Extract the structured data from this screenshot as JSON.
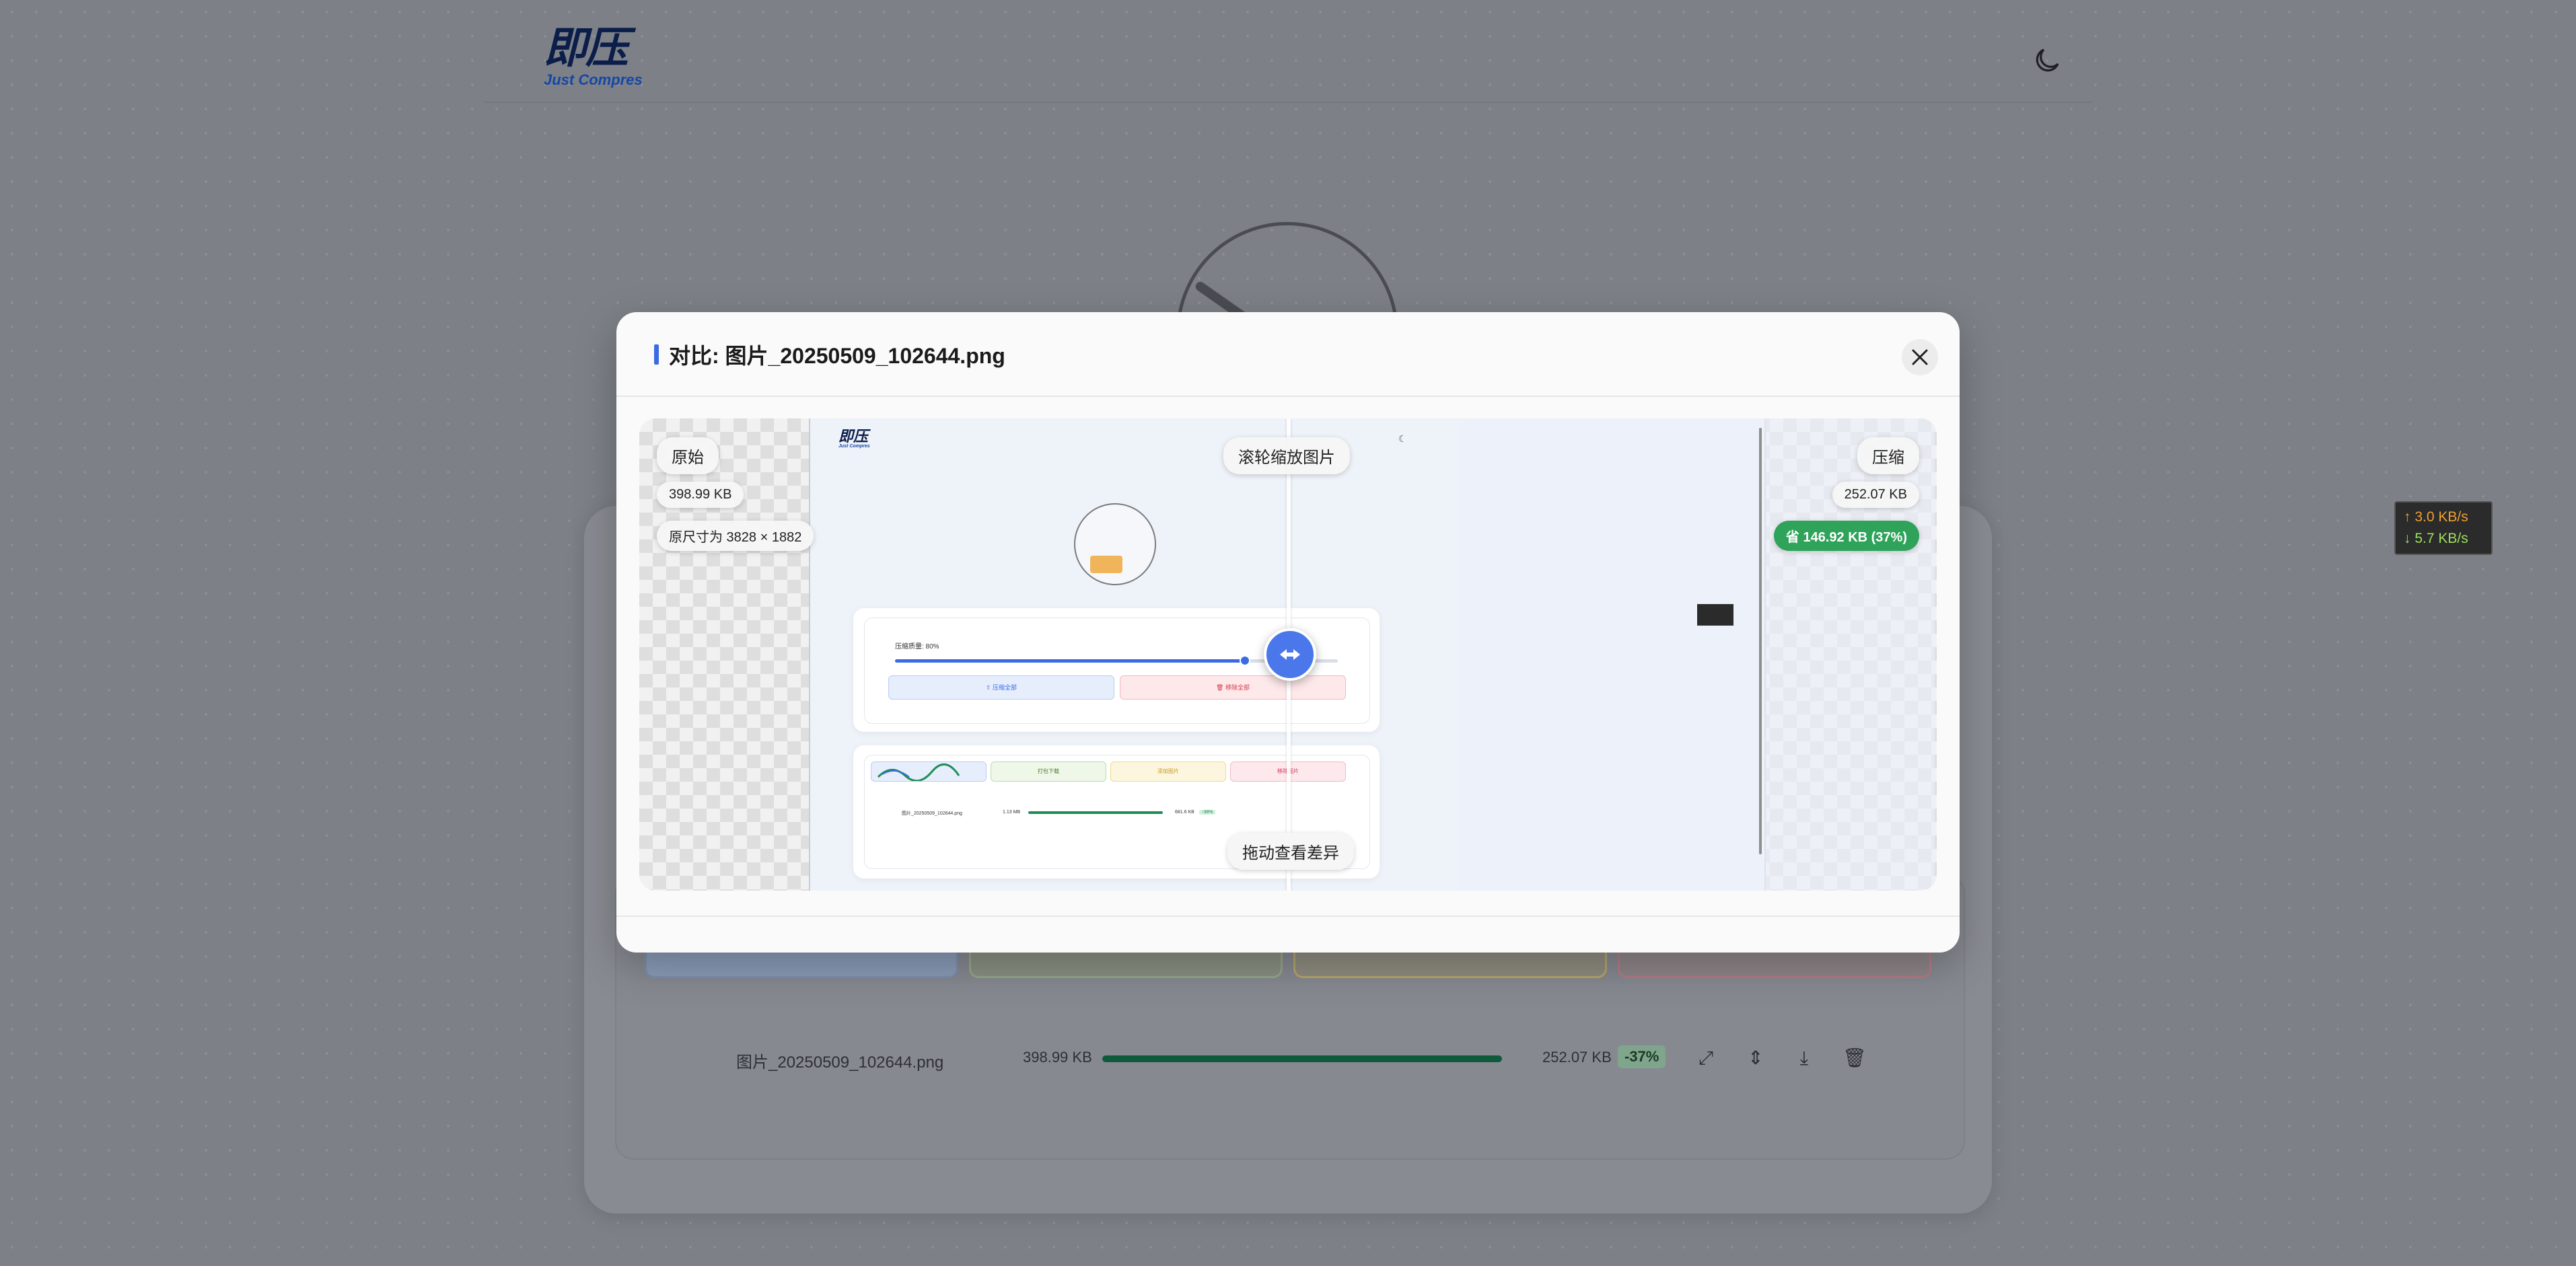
{
  "app": {
    "logo_text": "即压",
    "logo_subtitle": "Just Compres",
    "theme_toggle_icon": "moon-icon"
  },
  "background_list": {
    "file_name": "图片_20250509_102644.png",
    "original_size": "398.99 KB",
    "compressed_size": "252.07 KB",
    "change": "-37%",
    "progress": 1.0,
    "buttons": [
      "打包下载",
      "添加图片",
      "移除图片"
    ],
    "actions": [
      "expand-icon",
      "compare-icon",
      "download-icon",
      "trash-icon"
    ]
  },
  "network_speed": {
    "upload": "↑ 3.0 KB/s",
    "download": "↓ 5.7 KB/s"
  },
  "modal": {
    "title": "对比: 图片_20250509_102644.png",
    "close_icon": "close-icon",
    "hint_zoom": "滚轮缩放图片",
    "hint_drag": "拖动查看差异",
    "original": {
      "label": "原始",
      "size": "398.99 KB",
      "dimensions": "原尺寸为 3828 × 1882"
    },
    "compressed": {
      "label": "压缩",
      "size": "252.07 KB",
      "saved": "省 146.92 KB (37%)"
    },
    "preview": {
      "quality_label": "压缩质量: 80%",
      "quality_value": 0.8,
      "btn_compress_all": "⇧ 压缩全部",
      "btn_remove_all": "🗑 移除全部",
      "btn_pack": "打包下载",
      "btn_add": "添加图片",
      "btn_remove": "移除图片",
      "row_file": "图片_20250509_102644.png",
      "row_orig": "1.13 MB",
      "row_new": "681.6 KB",
      "row_pct": "-38%"
    }
  },
  "colors": {
    "accent": "#3b6be3",
    "success": "#2fa35a",
    "overlay": "#7c7f86"
  }
}
